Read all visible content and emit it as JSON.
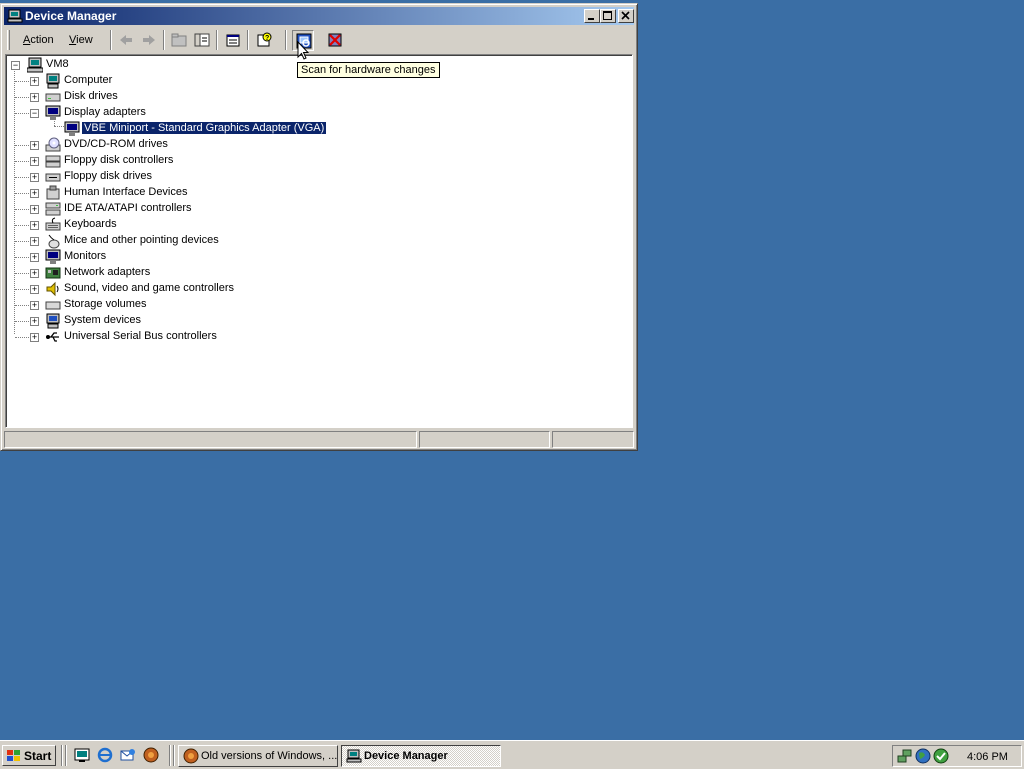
{
  "window": {
    "title": "Device Manager",
    "menu": [
      {
        "label": "Action",
        "underline": "A",
        "rest": "ction"
      },
      {
        "label": "View",
        "underline": "V",
        "rest": "iew"
      }
    ],
    "tooltip": "Scan for hardware changes"
  },
  "tree": {
    "root": "VM8",
    "categories": [
      {
        "label": "Computer",
        "icon": "computer-icon",
        "expanded": false
      },
      {
        "label": "Disk drives",
        "icon": "disk-drive-icon",
        "expanded": false
      },
      {
        "label": "Display adapters",
        "icon": "display-adapter-icon",
        "expanded": true
      },
      {
        "label": "DVD/CD-ROM drives",
        "icon": "cdrom-icon",
        "expanded": false
      },
      {
        "label": "Floppy disk controllers",
        "icon": "floppy-controller-icon",
        "expanded": false
      },
      {
        "label": "Floppy disk drives",
        "icon": "floppy-drive-icon",
        "expanded": false
      },
      {
        "label": "Human Interface Devices",
        "icon": "hid-icon",
        "expanded": false
      },
      {
        "label": "IDE ATA/ATAPI controllers",
        "icon": "ide-controller-icon",
        "expanded": false
      },
      {
        "label": "Keyboards",
        "icon": "keyboard-icon",
        "expanded": false
      },
      {
        "label": "Mice and other pointing devices",
        "icon": "mouse-icon",
        "expanded": false
      },
      {
        "label": "Monitors",
        "icon": "monitor-icon",
        "expanded": false
      },
      {
        "label": "Network adapters",
        "icon": "network-adapter-icon",
        "expanded": false
      },
      {
        "label": "Sound, video and game controllers",
        "icon": "sound-icon",
        "expanded": false
      },
      {
        "label": "Storage volumes",
        "icon": "storage-volume-icon",
        "expanded": false
      },
      {
        "label": "System devices",
        "icon": "system-device-icon",
        "expanded": false
      },
      {
        "label": "Universal Serial Bus controllers",
        "icon": "usb-icon",
        "expanded": false
      }
    ],
    "display_child": "VBE Miniport - Standard Graphics Adapter (VGA)"
  },
  "taskbar": {
    "start_label": "Start",
    "tasks": [
      {
        "label": "Old versions of Windows, ...",
        "active": false
      },
      {
        "label": "Device Manager",
        "active": true
      }
    ],
    "clock": "4:06 PM"
  },
  "colors": {
    "desktop": "#3a6ea5",
    "title_active_start": "#0a246a",
    "title_active_end": "#a6caf0",
    "face": "#d4d0c8",
    "selection": "#0a246a",
    "tooltip_bg": "#ffffe1"
  }
}
